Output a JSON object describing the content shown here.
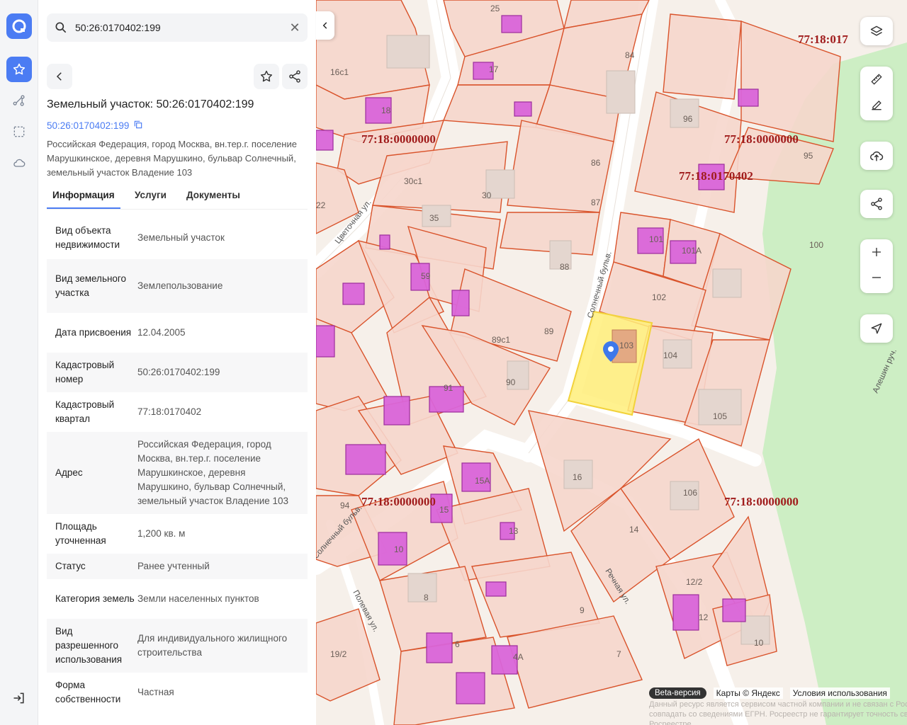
{
  "search": {
    "value": "50:26:0170402:199"
  },
  "panel": {
    "title": "Земельный участок: 50:26:0170402:199",
    "cadastral_link": "50:26:0170402:199",
    "address": "Российская Федерация, город Москва, вн.тер.г. поселение Марушкинское, деревня Марушкино, бульвар Солнечный, земельный участок Владение 103",
    "tabs": [
      "Информация",
      "Услуги",
      "Документы"
    ],
    "info": [
      {
        "k": "Вид объекта недвижимости",
        "v": "Земельный участок"
      },
      {
        "k": "Вид земельного участка",
        "v": "Землепользование"
      },
      {
        "k": "Дата присвоения",
        "v": "12.04.2005"
      },
      {
        "k": "Кадастровый номер",
        "v": "50:26:0170402:199"
      },
      {
        "k": "Кадастровый квартал",
        "v": "77:18:0170402"
      },
      {
        "k": "Адрес",
        "v": "Российская Федерация, город Москва, вн.тер.г. поселение Марушкинское, деревня Марушкино, бульвар Солнечный, земельный участок Владение 103"
      },
      {
        "k": "Площадь уточненная",
        "v": "1,200 кв. м"
      },
      {
        "k": "Статус",
        "v": "Ранее учтенный"
      },
      {
        "k": "Категория земель",
        "v": "Земли населенных пунктов"
      },
      {
        "k": "Вид разрешенного использования",
        "v": "Для индивидуального жилищного строительства"
      },
      {
        "k": "Форма собственности",
        "v": "Частная"
      }
    ]
  },
  "map": {
    "quarter_labels": [
      "77:18:0000000",
      "77:18:0000000",
      "77:18:0170402",
      "77:18:0000000",
      "77:18:0000000",
      "77:18:017"
    ],
    "plot_labels": [
      "25",
      "84",
      "16с1",
      "17",
      "18",
      "96",
      "95",
      "86",
      "30с1",
      "30",
      "87",
      "35",
      "22",
      "101",
      "101А",
      "100",
      "88",
      "102",
      "59",
      "89с1",
      "89",
      "103",
      "104",
      "105",
      "90",
      "91",
      "106",
      "16",
      "15А",
      "94",
      "14",
      "12/2",
      "15",
      "13",
      "10",
      "8",
      "9",
      "12",
      "6",
      "7",
      "10",
      "19/2",
      "4А"
    ],
    "street_labels": [
      "Цветочная ул.",
      "Солнечный бульв.",
      "Солнечный бульв.",
      "Полевая ул.",
      "Речная ул.",
      "Алешин руч."
    ],
    "footer": {
      "beta": "Beta-версия",
      "maps": "Карты © Яндекс",
      "terms": "Условия использования"
    },
    "disclaimer": "Данный ресурс является сервисом частной компании и не связан с Росреестром. Не является официальным источником сведений. Данные могут не совпадать со сведениями ЕГРН. Росреестр не гарантирует точность сведений. Данные получены в соответствии со сведениями, общедоступными в Росреестре."
  },
  "colors": {
    "accent": "#4b7cf3",
    "parcel_line": "#d9532b",
    "parcel_fill": "#f6d6cc",
    "building": "#d965d9",
    "selected": "#ffef7a",
    "label": "#a01c1c"
  }
}
